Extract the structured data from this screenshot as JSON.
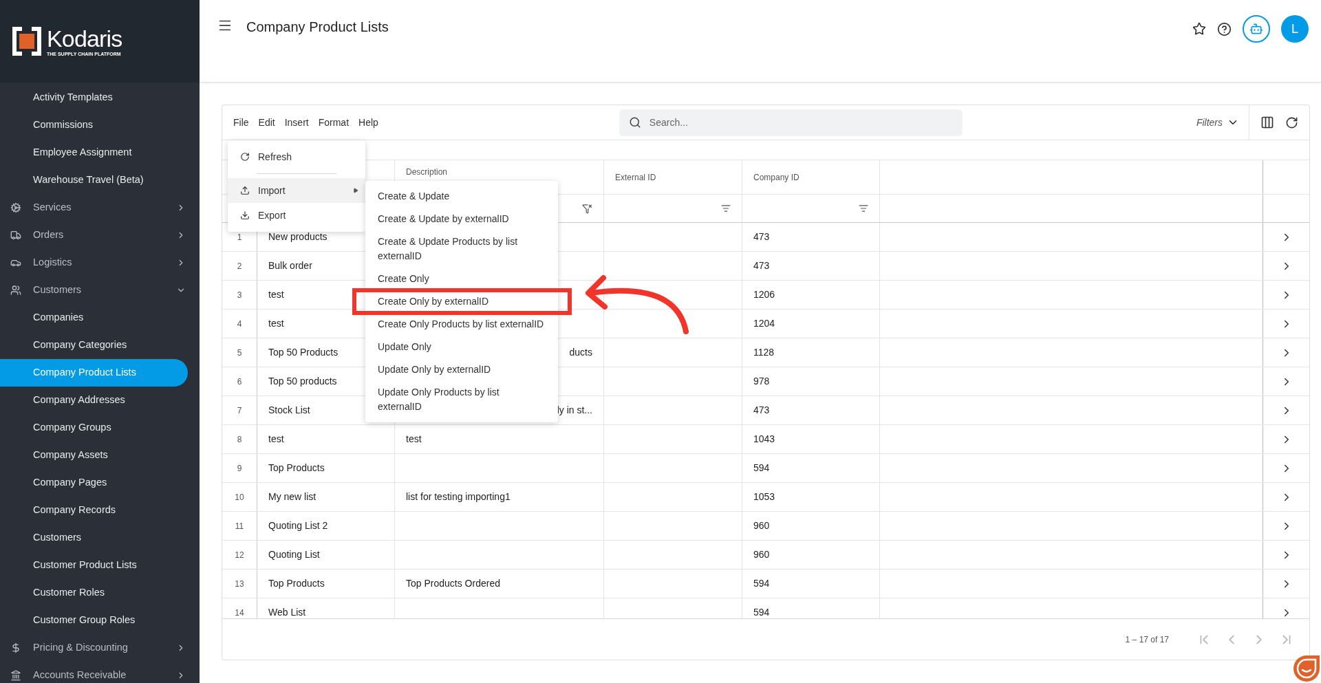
{
  "brand": {
    "name": "Kodaris",
    "tagline": "THE SUPPLY CHAIN PLATFORM"
  },
  "sidebar": {
    "items": [
      {
        "kind": "link",
        "label": "Activity Templates",
        "selected": false
      },
      {
        "kind": "link",
        "label": "Commissions",
        "selected": false
      },
      {
        "kind": "link",
        "label": "Employee Assignment",
        "selected": false
      },
      {
        "kind": "link",
        "label": "Warehouse Travel (Beta)",
        "selected": false
      },
      {
        "kind": "group",
        "label": "Services",
        "expanded": false
      },
      {
        "kind": "group",
        "label": "Orders",
        "expanded": false
      },
      {
        "kind": "group",
        "label": "Logistics",
        "expanded": false
      },
      {
        "kind": "group",
        "label": "Customers",
        "expanded": true
      },
      {
        "kind": "link",
        "label": "Companies",
        "selected": false
      },
      {
        "kind": "link",
        "label": "Company Categories",
        "selected": false
      },
      {
        "kind": "link",
        "label": "Company Product Lists",
        "selected": true
      },
      {
        "kind": "link",
        "label": "Company Addresses",
        "selected": false
      },
      {
        "kind": "link",
        "label": "Company Groups",
        "selected": false
      },
      {
        "kind": "link",
        "label": "Company Assets",
        "selected": false
      },
      {
        "kind": "link",
        "label": "Company Pages",
        "selected": false
      },
      {
        "kind": "link",
        "label": "Company Records",
        "selected": false
      },
      {
        "kind": "link",
        "label": "Customers",
        "selected": false
      },
      {
        "kind": "link",
        "label": "Customer Product Lists",
        "selected": false
      },
      {
        "kind": "link",
        "label": "Customer Roles",
        "selected": false
      },
      {
        "kind": "link",
        "label": "Customer Group Roles",
        "selected": false
      },
      {
        "kind": "group",
        "label": "Pricing & Discounting",
        "expanded": false
      },
      {
        "kind": "group",
        "label": "Accounts Receivable",
        "expanded": false
      }
    ]
  },
  "header": {
    "title": "Company Product Lists",
    "avatar": "L"
  },
  "toolbar": {
    "menus": [
      "File",
      "Edit",
      "Insert",
      "Format",
      "Help"
    ],
    "search": {
      "placeholder": "Search..."
    },
    "filters": "Filters"
  },
  "file_menu": {
    "items": [
      {
        "kind": "action",
        "label": "Refresh",
        "highlighted": false
      },
      {
        "kind": "submenu",
        "label": "Import",
        "highlighted": true
      },
      {
        "kind": "action",
        "label": "Export",
        "highlighted": false
      }
    ]
  },
  "import_menu": {
    "items": [
      {
        "label": "Create & Update",
        "marked": false
      },
      {
        "label": "Create & Update by externalID",
        "marked": false
      },
      {
        "label": "Create & Update Products by list externalID",
        "marked": false
      },
      {
        "label": "Create Only",
        "marked": false
      },
      {
        "label": "Create Only by externalID",
        "marked": true
      },
      {
        "label": "Create Only Products by list externalID",
        "marked": false
      },
      {
        "label": "Update Only",
        "marked": false
      },
      {
        "label": "Update Only by externalID",
        "marked": false
      },
      {
        "label": "Update Only Products by list externalID",
        "marked": false
      }
    ]
  },
  "table": {
    "columns": [
      "Description",
      "External ID",
      "Company ID"
    ],
    "rows": [
      {
        "number": "1",
        "name": "New products",
        "company_id": "473"
      },
      {
        "number": "2",
        "name": "Bulk order",
        "company_id": "473"
      },
      {
        "number": "3",
        "name": "test",
        "company_id": "1206"
      },
      {
        "number": "4",
        "name": "test",
        "company_id": "1204"
      },
      {
        "number": "5",
        "name": "Top 50 Products",
        "description_tail": "ducts",
        "company_id": "1128"
      },
      {
        "number": "6",
        "name": "Top 50 products",
        "company_id": "978"
      },
      {
        "number": "7",
        "name": "Stock List",
        "description_tail": "ly in st...",
        "company_id": "473"
      },
      {
        "number": "8",
        "name": "test",
        "description": "test",
        "company_id": "1043"
      },
      {
        "number": "9",
        "name": "Top Products",
        "company_id": "594"
      },
      {
        "number": "10",
        "name": "My new list",
        "description": "list for testing importing1",
        "company_id": "1053"
      },
      {
        "number": "11",
        "name": "Quoting List 2",
        "company_id": "960"
      },
      {
        "number": "12",
        "name": "Quoting List",
        "company_id": "960"
      },
      {
        "number": "13",
        "name": "Top Products",
        "description": "Top Products Ordered",
        "company_id": "594"
      },
      {
        "number": "14",
        "name": "Web List",
        "company_id": "594"
      }
    ],
    "pagination": "1 – 17 of 17"
  }
}
